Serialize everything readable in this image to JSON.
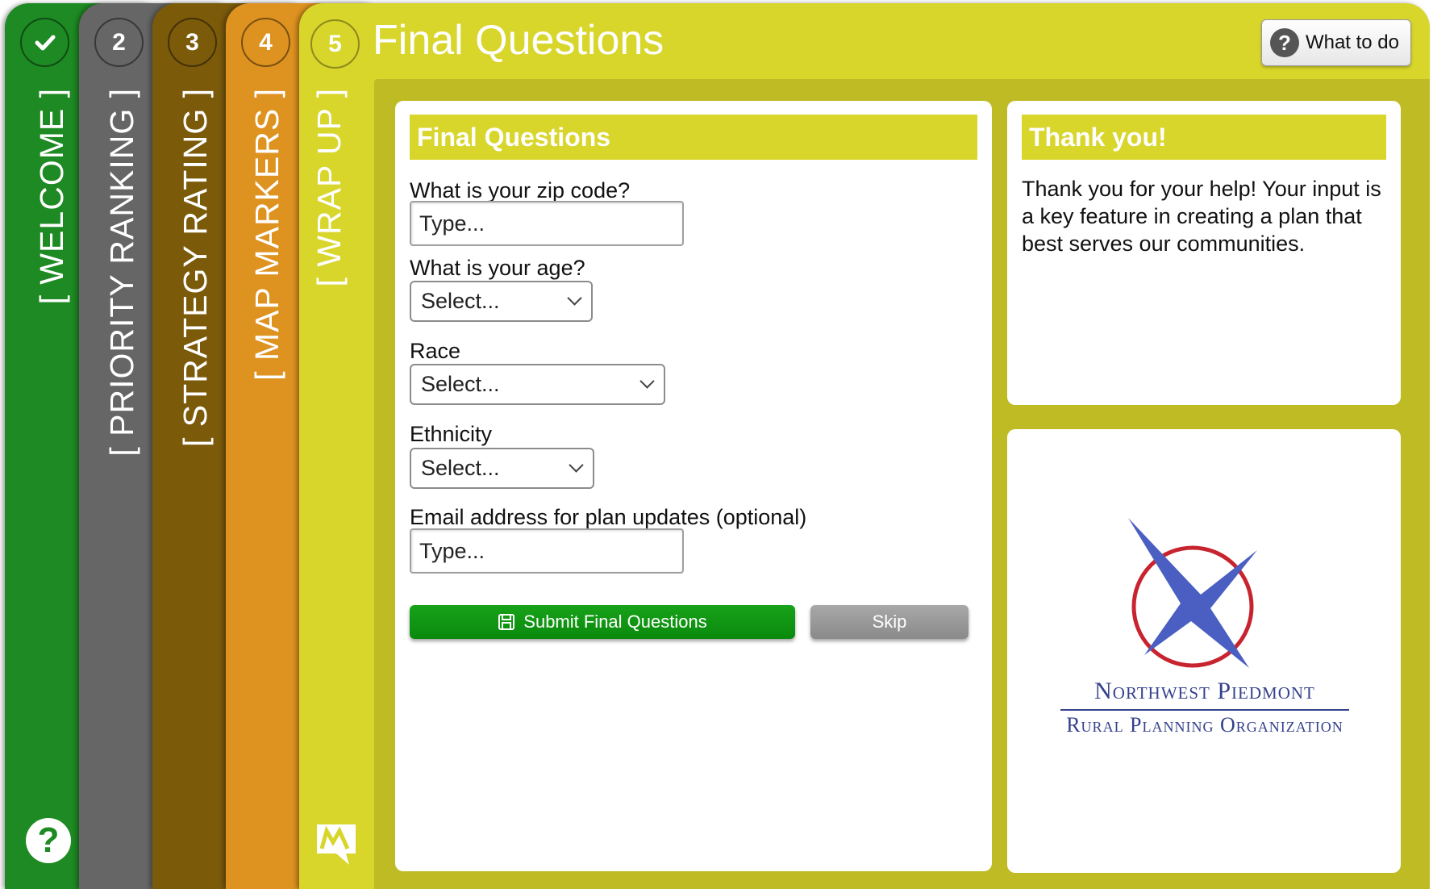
{
  "steps": [
    {
      "number": "",
      "icon": "check-icon",
      "label": "[ WELCOME ]",
      "color": "#1e8a23"
    },
    {
      "number": "2",
      "label": "[ PRIORITY RANKING ]",
      "color": "#666666"
    },
    {
      "number": "3",
      "label": "[ STRATEGY RATING ]",
      "color": "#7b5a0a"
    },
    {
      "number": "4",
      "label": "[ MAP MARKERS ]",
      "color": "#de921f"
    },
    {
      "number": "5",
      "label": "[ WRAP UP ]",
      "color": "#d8d52b"
    }
  ],
  "header": {
    "title": "Final Questions",
    "what_to_do_label": "What to do"
  },
  "form": {
    "title": "Final Questions",
    "zip_label": "What is your zip code?",
    "zip_placeholder": "Type...",
    "age_label": "What is your age?",
    "age_value": "Select...",
    "race_label": "Race",
    "race_value": "Select...",
    "ethnicity_label": "Ethnicity",
    "ethnicity_value": "Select...",
    "email_label": "Email address for plan updates (optional)",
    "email_placeholder": "Type...",
    "submit_label": "Submit Final Questions",
    "skip_label": "Skip"
  },
  "thanks": {
    "title": "Thank you!",
    "text": "Thank you for your help!  Your input is a key feature in creating a plan that best serves our communities."
  },
  "logo": {
    "line1": "Northwest Piedmont",
    "line2": "Rural Planning Organization"
  },
  "colors": {
    "active": "#d8d52b",
    "content_bg": "#bfbb25",
    "submit": "#0a8a0c",
    "logo_blue": "#34418c",
    "logo_red": "#c8242f"
  }
}
